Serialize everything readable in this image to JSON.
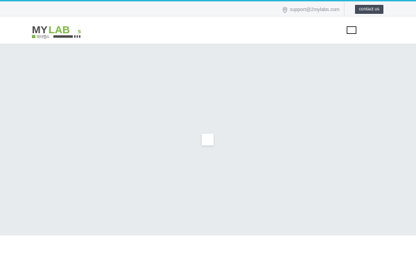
{
  "topbar": {
    "email": "support@2mylabs.com",
    "email_icon": "map-pin-icon",
    "contact_label": "contact us"
  },
  "header": {
    "logo": {
      "text_dark": "MY",
      "text_green": "LAB",
      "text_small": "s",
      "subtitle": "마이랩스"
    },
    "menu_icon": "menu-toggle-icon"
  },
  "hero": {
    "loader_icon": "loading-spinner-icon"
  },
  "colors": {
    "accent": "#29b6d8",
    "logo_green": "#7ab83e",
    "logo_dark": "#4a4a4a",
    "button_bg": "#454d5b",
    "hero_bg": "#e8ebee"
  }
}
